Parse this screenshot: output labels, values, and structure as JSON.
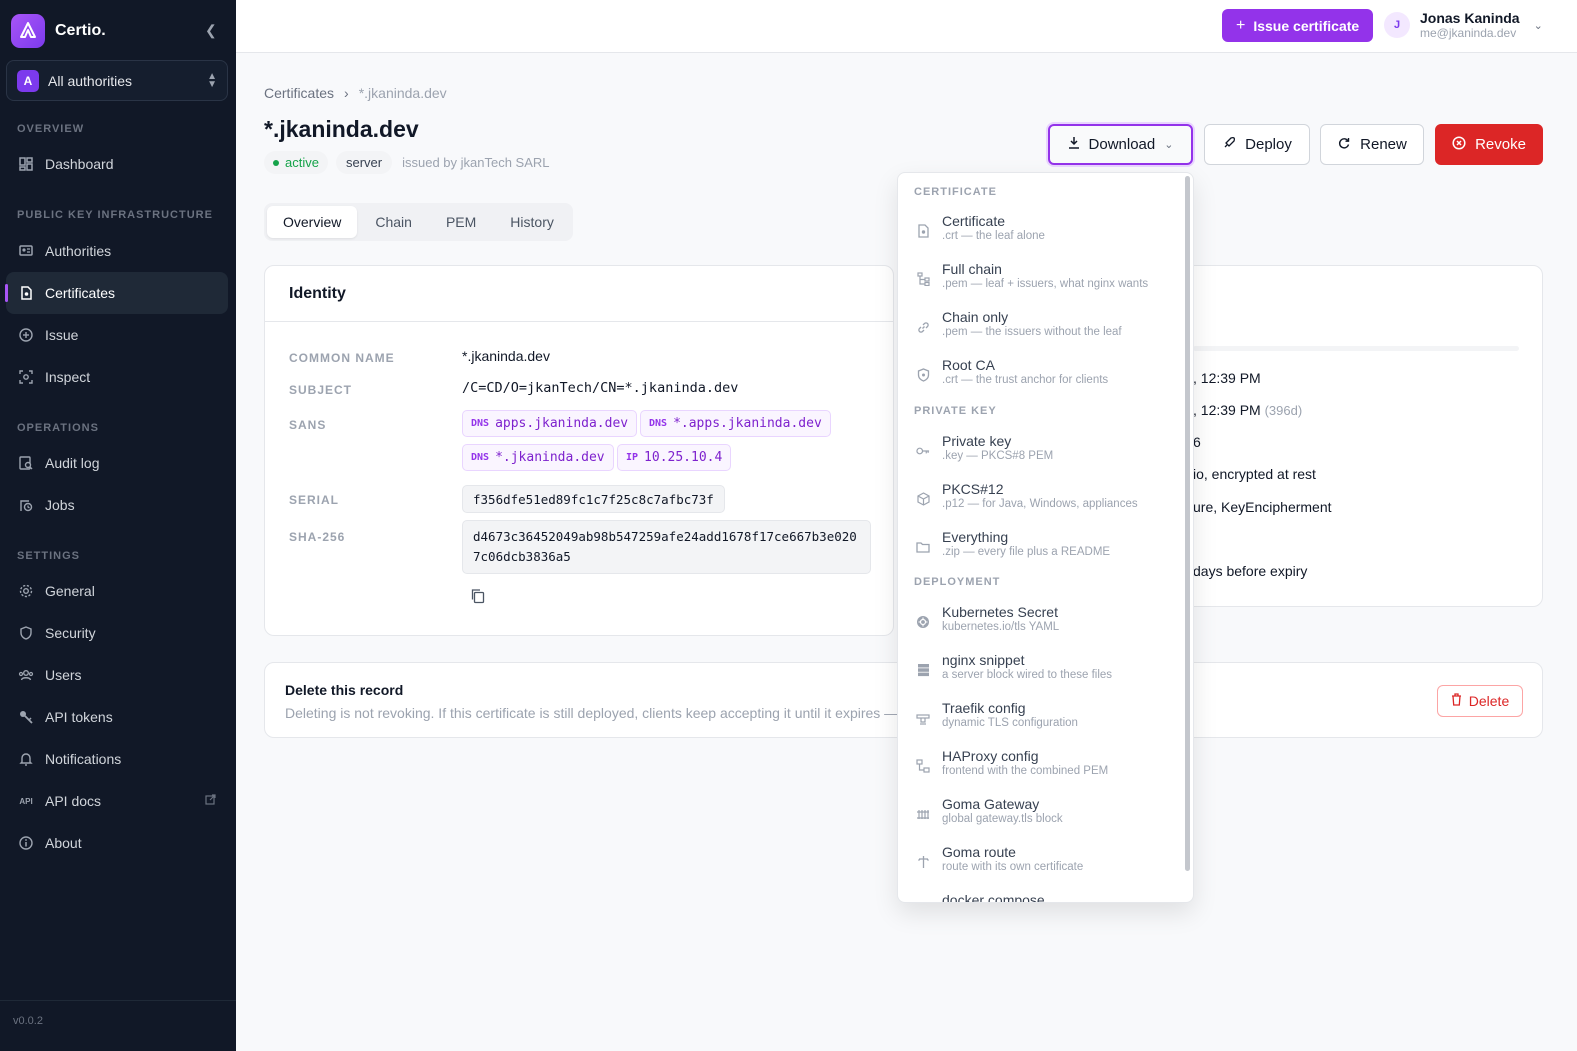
{
  "app": {
    "name": "Certio.",
    "version": "v0.0.2"
  },
  "authority_selector": {
    "badge": "A",
    "label": "All authorities"
  },
  "sidebar": {
    "sections": [
      {
        "label": "OVERVIEW"
      },
      {
        "label": "PUBLIC KEY INFRASTRUCTURE"
      },
      {
        "label": "OPERATIONS"
      },
      {
        "label": "SETTINGS"
      }
    ],
    "items": [
      {
        "label": "Dashboard",
        "icon": "dashboard-icon"
      },
      {
        "label": "Authorities",
        "icon": "authorities-icon"
      },
      {
        "label": "Certificates",
        "icon": "certificate-icon",
        "active": true
      },
      {
        "label": "Issue",
        "icon": "plus-circle-icon"
      },
      {
        "label": "Inspect",
        "icon": "inspect-icon"
      },
      {
        "label": "Audit log",
        "icon": "audit-log-icon"
      },
      {
        "label": "Jobs",
        "icon": "jobs-icon"
      },
      {
        "label": "General",
        "icon": "gear-icon"
      },
      {
        "label": "Security",
        "icon": "shield-icon"
      },
      {
        "label": "Users",
        "icon": "users-icon"
      },
      {
        "label": "API tokens",
        "icon": "key-icon"
      },
      {
        "label": "Notifications",
        "icon": "bell-icon"
      },
      {
        "label": "API docs",
        "icon": "api-icon",
        "api_text": "API"
      },
      {
        "label": "About",
        "icon": "info-icon"
      }
    ]
  },
  "topbar": {
    "issue_button": "Issue certificate",
    "user": {
      "initial": "J",
      "name": "Jonas Kaninda",
      "email": "me@jkaninda.dev"
    }
  },
  "breadcrumb": {
    "parent": "Certificates",
    "current": "*.jkaninda.dev"
  },
  "certificate": {
    "title": "*.jkaninda.dev",
    "status": "active",
    "type": "server",
    "issuer": "issued by jkanTech SARL"
  },
  "actions": {
    "download": "Download",
    "deploy": "Deploy",
    "renew": "Renew",
    "revoke": "Revoke"
  },
  "tabs": [
    "Overview",
    "Chain",
    "PEM",
    "History"
  ],
  "identity": {
    "heading": "Identity",
    "common_name_label": "COMMON NAME",
    "common_name": "*.jkaninda.dev",
    "subject_label": "SUBJECT",
    "subject": "/C=CD/O=jkanTech/CN=*.jkaninda.dev",
    "sans_label": "SANS",
    "sans": [
      {
        "kind": "DNS",
        "value": "apps.jkaninda.dev"
      },
      {
        "kind": "DNS",
        "value": "*.apps.jkaninda.dev"
      },
      {
        "kind": "DNS",
        "value": "*.jkaninda.dev"
      },
      {
        "kind": "IP",
        "value": "10.25.10.4"
      }
    ],
    "serial_label": "SERIAL",
    "serial": "f356dfe51ed89fc1c7f25c8c7afbc73f",
    "sha_label": "SHA-256",
    "sha_line1": "d4673c36452049ab98b547259afe24add1678f17ce667b3e020",
    "sha_line2": "7c06dcb3836a5"
  },
  "validity_card": {
    "line1": ", 12:39 PM",
    "line2": ", 12:39 PM",
    "line2_muted": "(396d)",
    "line3": "6",
    "line4": "io, encrypted at rest",
    "line5": "ure, KeyEncipherment",
    "line6": "days before expiry"
  },
  "delete_record": {
    "title": "Delete this record",
    "description": "Deleting is not revoking. If this certificate is still deployed, clients keep accepting it until it expires —",
    "button": "Delete"
  },
  "download_menu": {
    "sections": [
      {
        "label": "CERTIFICATE"
      },
      {
        "label": "PRIVATE KEY"
      },
      {
        "label": "DEPLOYMENT"
      }
    ],
    "items": [
      {
        "label": "Certificate",
        "sub": ".crt — the leaf alone",
        "icon": "certificate-file-icon"
      },
      {
        "label": "Full chain",
        "sub": ".pem — leaf + issuers, what nginx wants",
        "icon": "chain-tree-icon"
      },
      {
        "label": "Chain only",
        "sub": ".pem — the issuers without the leaf",
        "icon": "link-icon"
      },
      {
        "label": "Root CA",
        "sub": ".crt — the trust anchor for clients",
        "icon": "shield-icon"
      },
      {
        "label": "Private key",
        "sub": ".key — PKCS#8 PEM",
        "icon": "key-icon"
      },
      {
        "label": "PKCS#12",
        "sub": ".p12 — for Java, Windows, appliances",
        "icon": "package-icon"
      },
      {
        "label": "Everything",
        "sub": ".zip — every file plus a README",
        "icon": "folder-icon"
      },
      {
        "label": "Kubernetes Secret",
        "sub": "kubernetes.io/tls YAML",
        "icon": "kubernetes-icon"
      },
      {
        "label": "nginx snippet",
        "sub": "a server block wired to these files",
        "icon": "server-icon"
      },
      {
        "label": "Traefik config",
        "sub": "dynamic TLS configuration",
        "icon": "router-icon"
      },
      {
        "label": "HAProxy config",
        "sub": "frontend with the combined PEM",
        "icon": "network-icon"
      },
      {
        "label": "Goma Gateway",
        "sub": "global gateway.tls block",
        "icon": "gateway-icon"
      },
      {
        "label": "Goma route",
        "sub": "route with its own certificate",
        "icon": "route-icon"
      },
      {
        "label": "docker compose",
        "sub": "",
        "icon": "docker-icon"
      }
    ]
  },
  "colors": {
    "accent": "#9333ea",
    "danger": "#dc2626",
    "sidebar": "#111827",
    "success": "#16a34a"
  }
}
